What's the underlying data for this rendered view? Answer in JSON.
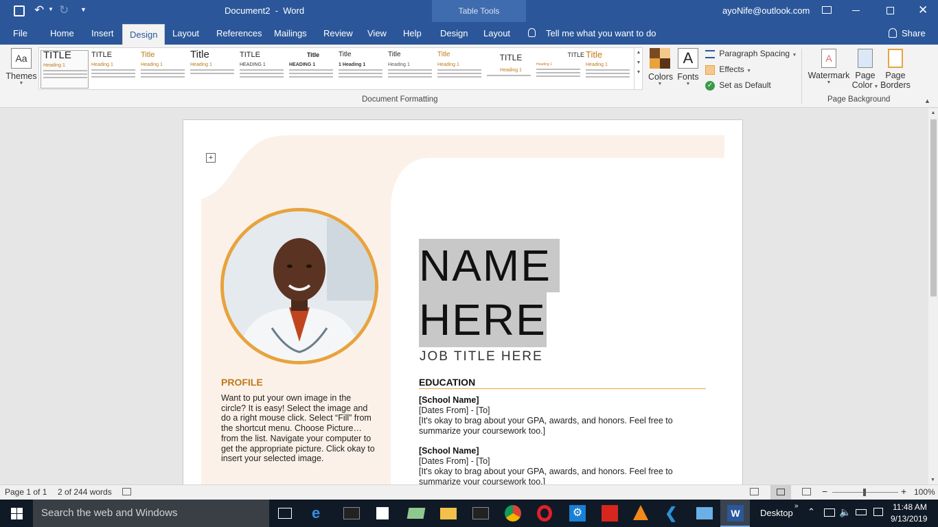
{
  "titlebar": {
    "doc_title": "Document2  -  Word",
    "context_tab": "Table Tools",
    "account": "ayoNife@outlook.com"
  },
  "tabs": [
    "File",
    "Home",
    "Insert",
    "Design",
    "Layout",
    "References",
    "Mailings",
    "Review",
    "View",
    "Help",
    "Design",
    "Layout"
  ],
  "active_tab": "Design",
  "tell_me": "Tell me what you want to do",
  "share": "Share",
  "ribbon": {
    "themes_label": "Themes",
    "gallery": [
      {
        "title": "TITLE",
        "heading": "Heading 1"
      },
      {
        "title": "TITLE",
        "heading": "Heading 1"
      },
      {
        "title": "Title",
        "heading": "Heading 1"
      },
      {
        "title": "Title",
        "heading": "Heading 1"
      },
      {
        "title": "TITLE",
        "heading": "HEADING 1"
      },
      {
        "title": "Title",
        "heading": "HEADING 1"
      },
      {
        "title": "Title",
        "heading": "1  Heading 1"
      },
      {
        "title": "Title",
        "heading": "Heading 1"
      },
      {
        "title": "Title",
        "heading": "Heading 1"
      },
      {
        "title": "TITLE",
        "heading": "Heading 1"
      },
      {
        "title": "TITLE",
        "heading": "Heading 1"
      },
      {
        "title": "Title",
        "heading": "Heading 1"
      }
    ],
    "colors_label": "Colors",
    "fonts_label": "Fonts",
    "paragraph_spacing": "Paragraph Spacing",
    "effects": "Effects",
    "set_default": "Set as Default",
    "doc_formatting_group": "Document Formatting",
    "watermark": "Watermark",
    "page_color_1": "Page",
    "page_color_2": "Color",
    "page_borders_1": "Page",
    "page_borders_2": "Borders",
    "page_background_group": "Page Background",
    "accent_color": "#2b579a"
  },
  "resume": {
    "name_line1": "NAME",
    "name_line2": "HERE",
    "job_title": "JOB TITLE HERE",
    "profile_heading": "PROFILE",
    "profile_text": "Want to put your own image in the circle?  It is easy!  Select the image and do a right mouse click.  Select “Fill” from the shortcut menu.  Choose Picture… from the list.  Navigate your computer to get the appropriate picture.  Click okay to insert your selected image.",
    "education_heading": "EDUCATION",
    "school_1": "[School Name]",
    "dates_1": "[Dates From] - [To]",
    "desc_1": "[It's okay to brag about your GPA, awards, and honors. Feel free to summarize your coursework too.]",
    "school_2": "[School Name]",
    "dates_2": "[Dates From] - [To]",
    "desc_2": "[It's okay to brag about your GPA, awards, and honors. Feel free to summarize your coursework too.]",
    "accent": "#e8a33d",
    "panel": "#fbf1e8"
  },
  "status": {
    "page": "Page 1 of 1",
    "words": "2 of 244 words",
    "zoom": "100%"
  },
  "taskbar": {
    "search": "Search the web and Windows",
    "desktop": "Desktop",
    "time": "11:48 AM",
    "date": "9/13/2019"
  }
}
